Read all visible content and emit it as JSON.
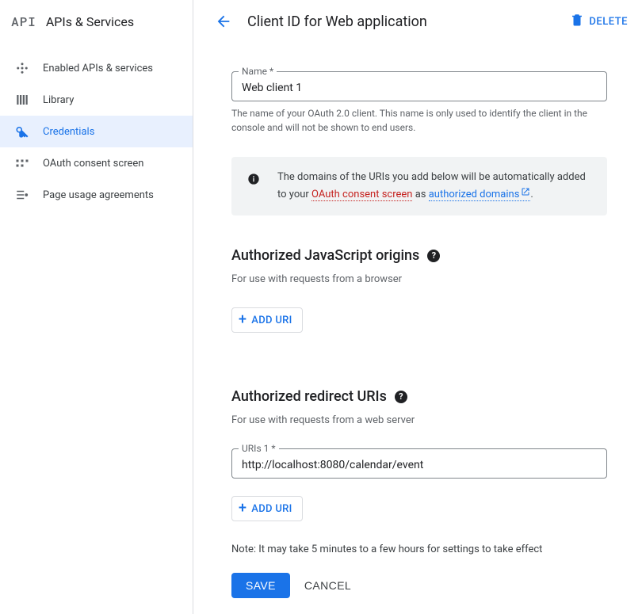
{
  "sidebar": {
    "logo": "API",
    "title": "APIs & Services",
    "items": [
      {
        "label": "Enabled APIs & services"
      },
      {
        "label": "Library"
      },
      {
        "label": "Credentials"
      },
      {
        "label": "OAuth consent screen"
      },
      {
        "label": "Page usage agreements"
      }
    ]
  },
  "header": {
    "title": "Client ID for Web application",
    "delete_label": "DELETE"
  },
  "name_field": {
    "label": "Name *",
    "value": "Web client 1",
    "helper": "The name of your OAuth 2.0 client. This name is only used to identify the client in the console and will not be shown to end users."
  },
  "info": {
    "prefix": "The domains of the URIs you add below will be automatically added to your ",
    "link1": "OAuth consent screen",
    "mid": " as ",
    "link2": "authorized domains",
    "suffix": "."
  },
  "js_origins": {
    "title": "Authorized JavaScript origins",
    "sub": "For use with requests from a browser",
    "add": "ADD URI"
  },
  "redirect": {
    "title": "Authorized redirect URIs",
    "sub": "For use with requests from a web server",
    "uri_label": "URIs 1 *",
    "uri_value": "http://localhost:8080/calendar/event",
    "add": "ADD URI"
  },
  "note": "Note: It may take 5 minutes to a few hours for settings to take effect",
  "buttons": {
    "save": "SAVE",
    "cancel": "CANCEL"
  }
}
